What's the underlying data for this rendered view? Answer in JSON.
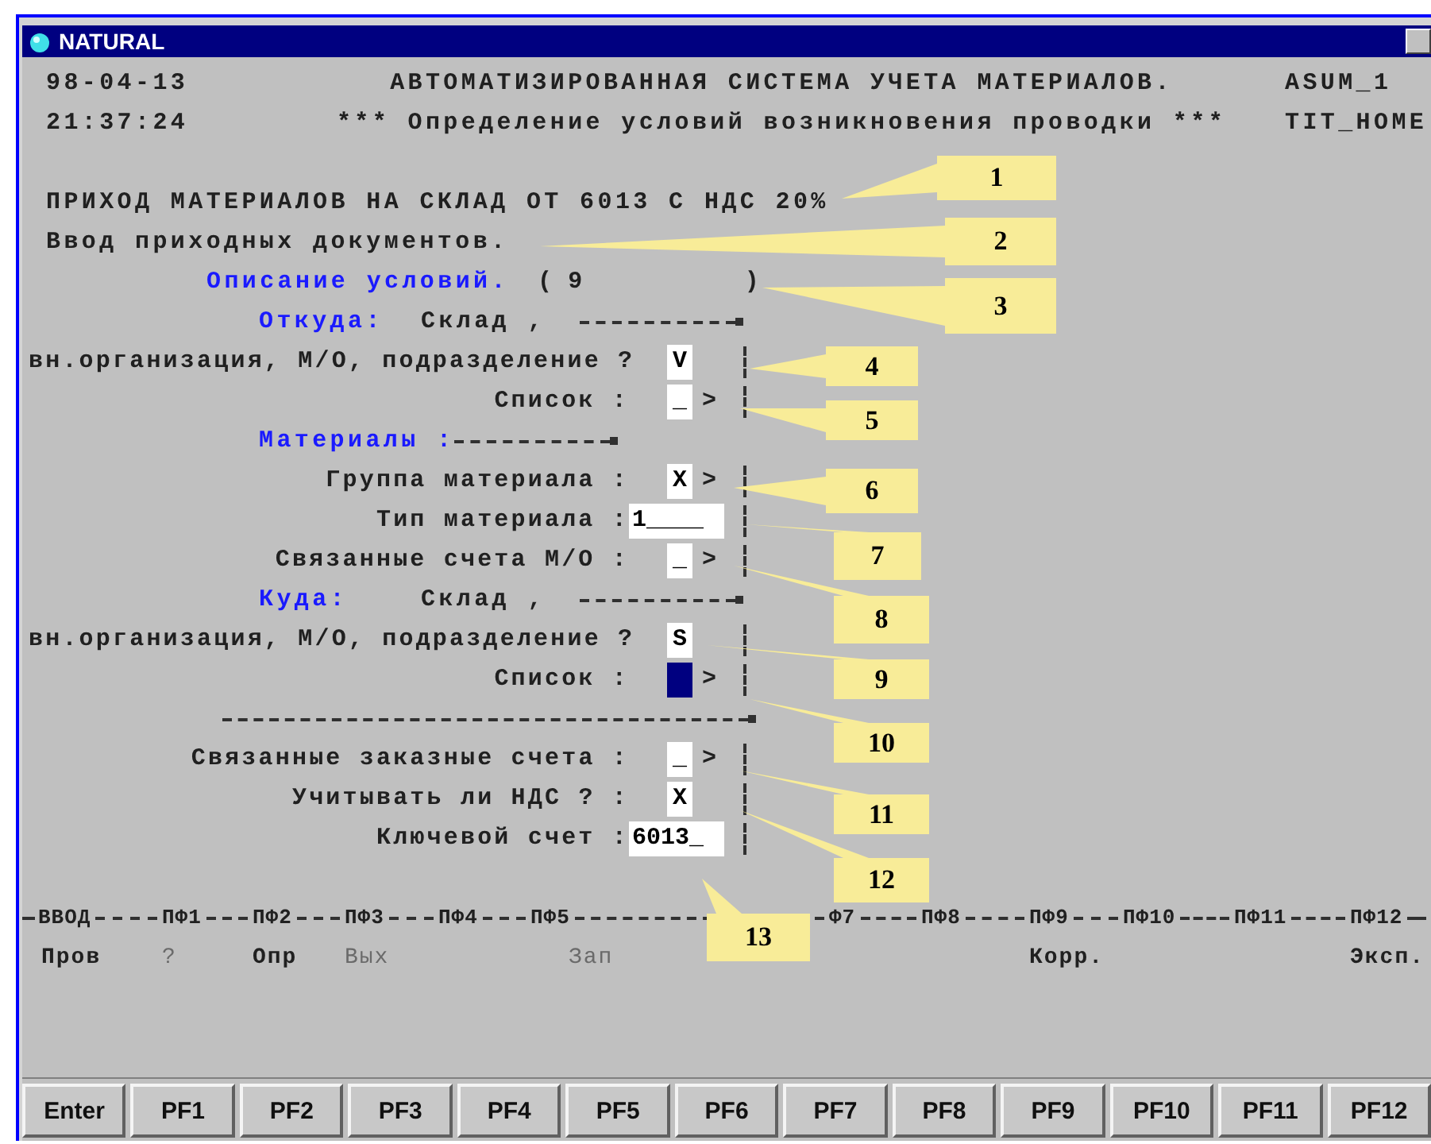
{
  "window": {
    "title": "NATURAL"
  },
  "header": [
    {
      "left": "98-04-13",
      "center": "АВТОМАТИЗИРОВАННАЯ СИСТЕМА УЧЕТА МАТЕРИАЛОВ.",
      "right": "ASUM_1"
    },
    {
      "left": "21:37:24",
      "center": "*** Определение условий возникновения проводки ***",
      "right": "TIT_HOME"
    }
  ],
  "operation": "ПРИХОД МАТЕРИАЛОВ НА СКЛАД ОТ 6013 С НДС 20%",
  "mode": "Ввод приходных документов.",
  "form": {
    "rows": [
      {
        "kind": "description",
        "label": "Описание условий.",
        "open": "(",
        "value": "9",
        "close": ")"
      },
      {
        "kind": "section",
        "title": "Откуда:",
        "place": "Склад ,"
      },
      {
        "kind": "char_field",
        "label": "вн.организация, М/О, подразделение ?",
        "field": {
          "value": "V",
          "focused": false
        }
      },
      {
        "kind": "char_field",
        "label": "Список :",
        "field": {
          "value": "_",
          "focused": false
        },
        "arrow": ">"
      },
      {
        "kind": "section",
        "title": "Материалы :"
      },
      {
        "kind": "char_field",
        "label": "Группа материала :",
        "field": {
          "value": "X",
          "focused": false
        },
        "arrow": ">"
      },
      {
        "kind": "text_field",
        "label": "Тип материала :",
        "field": {
          "value": "1____",
          "focused": false
        }
      },
      {
        "kind": "char_field",
        "label": "Связанные счета М/О :",
        "field": {
          "value": "_",
          "focused": false
        },
        "arrow": ">"
      },
      {
        "kind": "section",
        "title": "Куда:",
        "place": "Склад ,"
      },
      {
        "kind": "char_field",
        "label": "вн.организация, М/О, подразделение ?",
        "field": {
          "value": "S",
          "focused": false
        }
      },
      {
        "kind": "char_field",
        "label": "Список :",
        "field": {
          "focused": true
        },
        "arrow": ">"
      },
      {
        "kind": "separator"
      },
      {
        "kind": "char_field",
        "label": "Связанные заказные счета :",
        "field": {
          "value": "_",
          "focused": false
        },
        "arrow": ">"
      },
      {
        "kind": "char_field",
        "label": "Учитывать ли НДС ? :",
        "field": {
          "value": "X",
          "focused": false
        }
      },
      {
        "kind": "text_field",
        "label": "Ключевой счет :",
        "field": {
          "value": "6013_",
          "focused": false
        }
      }
    ]
  },
  "pf_keys": [
    {
      "key": "ВВОД",
      "label": "Пров",
      "disabled": false
    },
    {
      "key": "ПФ1",
      "label": "?",
      "disabled": true
    },
    {
      "key": "ПФ2",
      "label": "Опр",
      "disabled": false
    },
    {
      "key": "ПФ3",
      "label": "Вых",
      "disabled": true
    },
    {
      "key": "ПФ4"
    },
    {
      "key": "ПФ5",
      "label": "Зап",
      "disabled": true
    },
    {
      "key": "Ф7"
    },
    {
      "key": "ПФ8"
    },
    {
      "key": "ПФ9",
      "label": "Корр.",
      "disabled": false
    },
    {
      "key": "ПФ10"
    },
    {
      "key": "ПФ11"
    },
    {
      "key": "ПФ12",
      "label": "Эксп.",
      "disabled": false
    }
  ],
  "buttons": [
    "Enter",
    "PF1",
    "PF2",
    "PF3",
    "PF4",
    "PF5",
    "PF6",
    "PF7",
    "PF8",
    "PF9",
    "PF10",
    "PF11",
    "PF12"
  ],
  "callouts": [
    {
      "number": "1"
    },
    {
      "number": "2"
    },
    {
      "number": "3"
    },
    {
      "number": "4"
    },
    {
      "number": "5"
    },
    {
      "number": "6"
    },
    {
      "number": "7"
    },
    {
      "number": "8"
    },
    {
      "number": "9"
    },
    {
      "number": "10"
    },
    {
      "number": "11"
    },
    {
      "number": "12"
    },
    {
      "number": "13"
    }
  ]
}
